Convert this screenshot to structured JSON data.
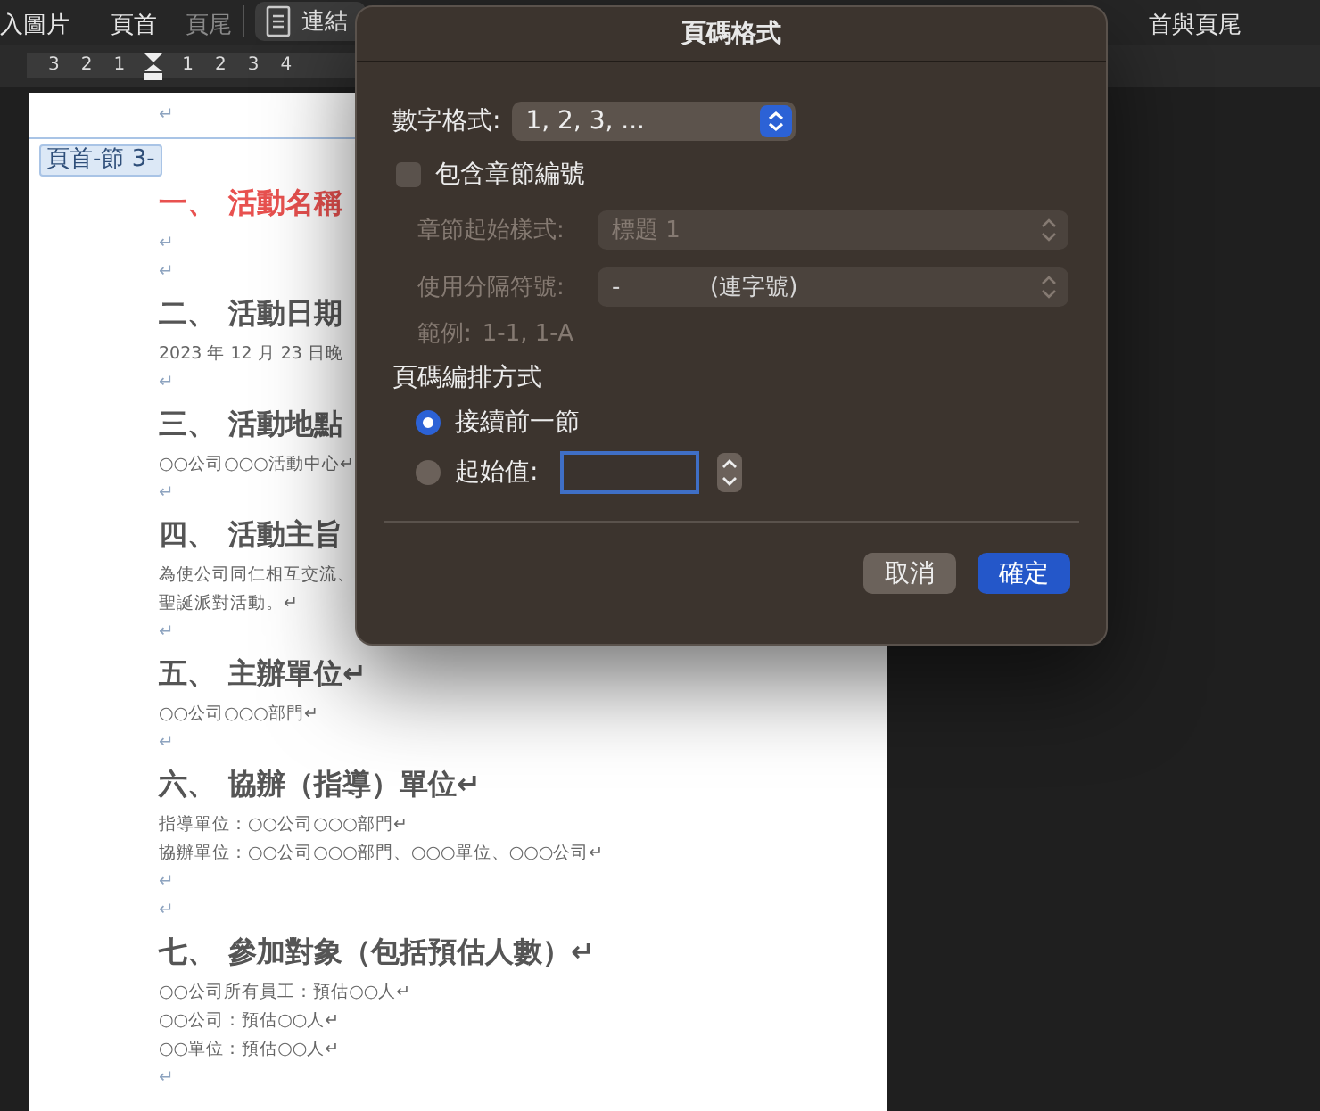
{
  "toolbar": {
    "items": [
      {
        "label": "入圖片",
        "disabled": false
      },
      {
        "label": "頁首",
        "disabled": false
      },
      {
        "label": "頁尾",
        "disabled": true
      },
      {
        "label": "連結",
        "kind": "icon-button",
        "disabled": false
      },
      {
        "label": "首與頁尾",
        "disabled": false
      }
    ]
  },
  "ruler": {
    "left_labels": [
      "3",
      "2",
      "1"
    ],
    "right_labels": [
      "1",
      "2",
      "3",
      "4"
    ]
  },
  "document": {
    "top_mark": "↵",
    "header_tag": "頁首-節 3-",
    "paragraphs": [
      {
        "kind": "heading",
        "number": "一、",
        "text": "活動名稱",
        "color": "#e8514f"
      },
      {
        "kind": "mark",
        "text": "↵"
      },
      {
        "kind": "mark",
        "text": "↵"
      },
      {
        "kind": "heading",
        "number": "二、",
        "text": "活動日期",
        "color": "#555555"
      },
      {
        "kind": "body",
        "text": "2023 年 12 月 23 日晚"
      },
      {
        "kind": "mark",
        "text": "↵"
      },
      {
        "kind": "heading",
        "number": "三、",
        "text": "活動地點",
        "color": "#555555"
      },
      {
        "kind": "body",
        "text": "○○公司○○○活動中心↵"
      },
      {
        "kind": "mark",
        "text": "↵"
      },
      {
        "kind": "heading",
        "number": "四、",
        "text": "活動主旨",
        "color": "#555555"
      },
      {
        "kind": "body",
        "text": "為使公司同仁相互交流、"
      },
      {
        "kind": "body",
        "text": "聖誕派對活動。↵"
      },
      {
        "kind": "mark",
        "text": "↵"
      },
      {
        "kind": "heading",
        "number": "五、",
        "text": "主辦單位↵",
        "color": "#555555"
      },
      {
        "kind": "body",
        "text": "○○公司○○○部門↵"
      },
      {
        "kind": "mark",
        "text": "↵"
      },
      {
        "kind": "heading",
        "number": "六、",
        "text": "協辦（指導）單位↵",
        "color": "#555555"
      },
      {
        "kind": "body",
        "text": "指導單位：○○公司○○○部門↵"
      },
      {
        "kind": "body",
        "text": "協辦單位：○○公司○○○部門、○○○單位、○○○公司↵"
      },
      {
        "kind": "mark",
        "text": "↵"
      },
      {
        "kind": "mark",
        "text": "↵"
      },
      {
        "kind": "heading",
        "number": "七、",
        "text": "參加對象（包括預估人數）↵",
        "color": "#555555"
      },
      {
        "kind": "body",
        "text": "○○公司所有員工：預估○○人↵"
      },
      {
        "kind": "body",
        "text": "○○公司：預估○○人↵"
      },
      {
        "kind": "body",
        "text": "○○單位：預估○○人↵"
      },
      {
        "kind": "mark",
        "text": "↵"
      }
    ]
  },
  "dialog": {
    "title": "頁碼格式",
    "number_format": {
      "label": "數字格式:",
      "value": "1, 2, 3, ..."
    },
    "include_chapter": {
      "label": "包含章節編號",
      "checked": false
    },
    "chapter_style": {
      "label": "章節起始樣式:",
      "value": "標題 1",
      "disabled": true
    },
    "separator": {
      "label": "使用分隔符號:",
      "value": "-",
      "note": "(連字號)",
      "disabled": true
    },
    "example": {
      "label": "範例:",
      "value": "1-1, 1-A",
      "disabled": true
    },
    "numbering": {
      "label": "頁碼編排方式",
      "options": [
        {
          "label": "接續前一節",
          "selected": true
        },
        {
          "label": "起始值:",
          "selected": false
        }
      ]
    },
    "start_value": {
      "focused": true
    },
    "buttons": [
      {
        "label": "取消",
        "kind": "cancel"
      },
      {
        "label": "確定",
        "kind": "default"
      }
    ]
  }
}
